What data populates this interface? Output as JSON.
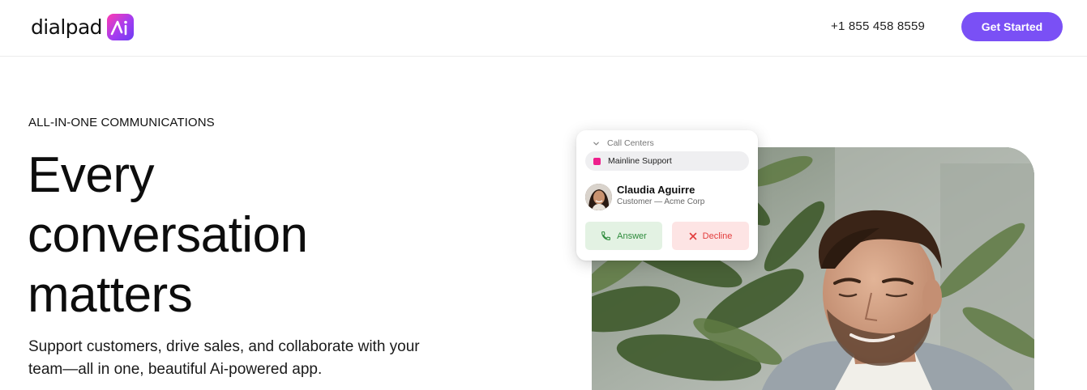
{
  "header": {
    "logo_text": "dialpad",
    "logo_badge_text": "Ai",
    "phone": "+1 855 458 8559",
    "cta_label": "Get Started"
  },
  "hero": {
    "eyebrow": "ALL-IN-ONE COMMUNICATIONS",
    "headline_lines": [
      "Every",
      "conversation",
      "matters"
    ],
    "subhead": "Support customers, drive sales, and collaborate with your team—all in one, beautiful Ai-powered app."
  },
  "call_card": {
    "section_label": "Call Centers",
    "queue_name": "Mainline Support",
    "caller_name": "Claudia Aguirre",
    "caller_detail": "Customer — Acme Corp",
    "answer_label": "Answer",
    "decline_label": "Decline",
    "icons": {
      "section": "chevron-down-icon",
      "answer": "phone-icon",
      "decline": "close-icon"
    }
  },
  "colors": {
    "brand_purple": "#7a50f5",
    "queue_pink": "#ee1f8c",
    "answer_green": "#2e8b3c",
    "decline_red": "#e23c3c"
  }
}
